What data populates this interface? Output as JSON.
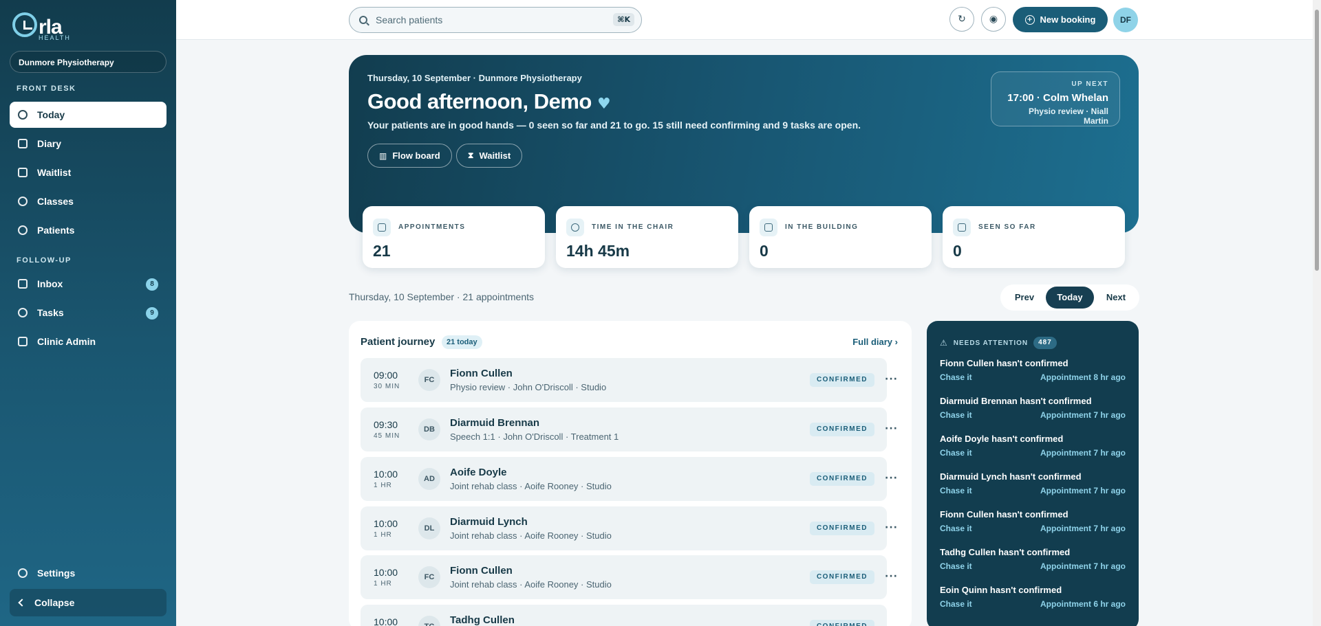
{
  "sidebar": {
    "logo_text": "rla",
    "logo_sub": "HEALTH",
    "clinic": "Dunmore Physiotherapy",
    "front_desk_label": "FRONT DESK",
    "followup_label": "FOLLOW-UP",
    "items": [
      {
        "label": "Today"
      },
      {
        "label": "Diary"
      },
      {
        "label": "Waitlist"
      },
      {
        "label": "Classes"
      },
      {
        "label": "Patients"
      },
      {
        "label": "Inbox",
        "badge": "8"
      },
      {
        "label": "Tasks",
        "badge": "9"
      },
      {
        "label": "Clinic Admin"
      }
    ],
    "settings": "Settings",
    "collapse": "Collapse"
  },
  "topbar": {
    "search_placeholder": "Search patients",
    "shortcut": "⌘K",
    "new_booking": "New booking",
    "avatar": "DF"
  },
  "hero": {
    "date": "Thursday, 10 September · Dunmore Physiotherapy",
    "greeting": "Good afternoon, Demo",
    "summary": "Your patients are in good hands — 0 seen so far and 21 to go. 15 still need confirming and 9 tasks are open.",
    "flow_board": "Flow board",
    "waitlist": "Waitlist",
    "up_next_label": "UP NEXT",
    "up_next_time": "17:00 · Colm Whelan",
    "up_next_sub": "Physio review · Niall Martin"
  },
  "stats": [
    {
      "label": "APPOINTMENTS",
      "value": "21"
    },
    {
      "label": "TIME IN THE CHAIR",
      "value": "14h 45m"
    },
    {
      "label": "IN THE BUILDING",
      "value": "0"
    },
    {
      "label": "SEEN SO FAR",
      "value": "0"
    }
  ],
  "date_row": "Thursday, 10 September · 21 appointments",
  "pager": {
    "prev": "Prev",
    "today": "Today",
    "next": "Next"
  },
  "journey": {
    "title": "Patient journey",
    "badge": "21 today",
    "full_diary": "Full diary",
    "appointments": [
      {
        "time": "09:00",
        "dur": "30 MIN",
        "initials": "FC",
        "name": "Fionn Cullen",
        "detail": "Physio review · John O'Driscoll · Studio",
        "status": "CONFIRMED"
      },
      {
        "time": "09:30",
        "dur": "45 MIN",
        "initials": "DB",
        "name": "Diarmuid Brennan",
        "detail": "Speech 1:1 · John O'Driscoll · Treatment 1",
        "status": "CONFIRMED"
      },
      {
        "time": "10:00",
        "dur": "1 HR",
        "initials": "AD",
        "name": "Aoife Doyle",
        "detail": "Joint rehab class · Aoife Rooney · Studio",
        "status": "CONFIRMED"
      },
      {
        "time": "10:00",
        "dur": "1 HR",
        "initials": "DL",
        "name": "Diarmuid Lynch",
        "detail": "Joint rehab class · Aoife Rooney · Studio",
        "status": "CONFIRMED"
      },
      {
        "time": "10:00",
        "dur": "1 HR",
        "initials": "FC",
        "name": "Fionn Cullen",
        "detail": "Joint rehab class · Aoife Rooney · Studio",
        "status": "CONFIRMED"
      },
      {
        "time": "10:00",
        "dur": "",
        "initials": "TC",
        "name": "Tadhg Cullen",
        "detail": "",
        "status": "CONFIRMED"
      }
    ]
  },
  "attention": {
    "label": "NEEDS ATTENTION",
    "count": "487",
    "items": [
      {
        "title": "Fionn Cullen hasn't confirmed",
        "action": "Chase it",
        "when": "Appointment 8 hr ago"
      },
      {
        "title": "Diarmuid Brennan hasn't confirmed",
        "action": "Chase it",
        "when": "Appointment 7 hr ago"
      },
      {
        "title": "Aoife Doyle hasn't confirmed",
        "action": "Chase it",
        "when": "Appointment 7 hr ago"
      },
      {
        "title": "Diarmuid Lynch hasn't confirmed",
        "action": "Chase it",
        "when": "Appointment 7 hr ago"
      },
      {
        "title": "Fionn Cullen hasn't confirmed",
        "action": "Chase it",
        "when": "Appointment 7 hr ago"
      },
      {
        "title": "Tadhg Cullen hasn't confirmed",
        "action": "Chase it",
        "when": "Appointment 7 hr ago"
      },
      {
        "title": "Eoin Quinn hasn't confirmed",
        "action": "Chase it",
        "when": "Appointment 6 hr ago"
      }
    ]
  }
}
